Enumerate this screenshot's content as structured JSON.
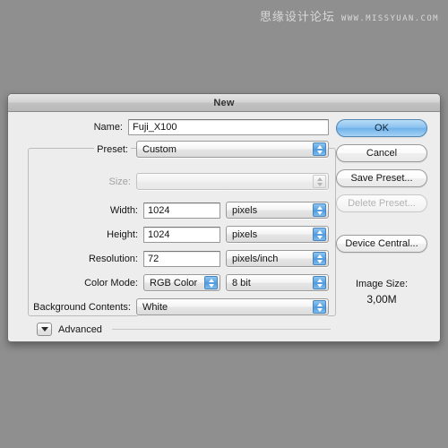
{
  "watermark": {
    "chinese": "思缘设计论坛",
    "url": "WWW.MISSYUAN.COM"
  },
  "dialog": {
    "title": "New",
    "name": {
      "label": "Name:",
      "value": "Fuji_X100"
    },
    "preset": {
      "label": "Preset:",
      "value": "Custom"
    },
    "size": {
      "label": "Size:",
      "value": ""
    },
    "width": {
      "label": "Width:",
      "value": "1024",
      "unit": "pixels"
    },
    "height": {
      "label": "Height:",
      "value": "1024",
      "unit": "pixels"
    },
    "resolution": {
      "label": "Resolution:",
      "value": "72",
      "unit": "pixels/inch"
    },
    "color_mode": {
      "label": "Color Mode:",
      "value": "RGB Color",
      "depth": "8 bit"
    },
    "background_contents": {
      "label": "Background Contents:",
      "value": "White"
    },
    "advanced": {
      "label": "Advanced"
    },
    "buttons": {
      "ok": "OK",
      "cancel": "Cancel",
      "save_preset": "Save Preset...",
      "delete_preset": "Delete Preset...",
      "device_central": "Device Central..."
    },
    "image_size": {
      "label": "Image Size:",
      "value": "3,00M"
    }
  },
  "colors": {
    "desktop": "#8f8f8f",
    "dialog_bg": "#ededed",
    "accent_blue": "#5ba4e2",
    "primary_button": "#8cc3ef"
  }
}
